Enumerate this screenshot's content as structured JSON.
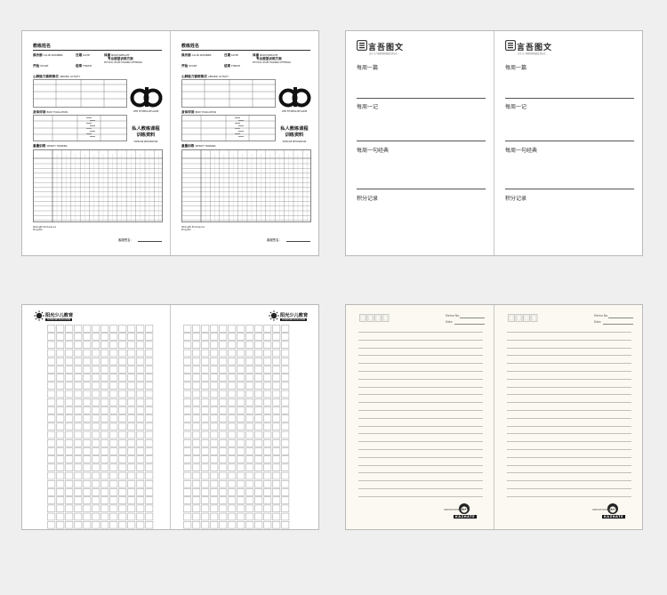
{
  "colors": {
    "background": "#efefef",
    "paper": "#ffffff",
    "paper_cream": "#fbf9f1",
    "grid_line": "#9a9a9a",
    "text": "#222222"
  },
  "training": {
    "title": "教练姓名",
    "club_label": "俱乐部",
    "club_en": "CLUB NUMBER",
    "date_label": "日期",
    "date_en": "DATE",
    "address_label": "开始",
    "address_en": "START",
    "end_label": "结束",
    "end_en": "FINISH",
    "weight_label": "体重",
    "weight_en": "BODYWEIGHT",
    "goal_label": "专业塑型训练方案",
    "goal_en": "PHYSICAL SHAPE TRAINING OFFERINGS",
    "sec1": "心肺能力锻炼情况",
    "sec1_en": "AEROBIC ACTIVITY",
    "sec2": "身体评测",
    "sec2_en": "BODY EVALUATION",
    "sec3": "重量训练",
    "sec3_en": "WEIGHT TRAINING",
    "logo_caption": "DFB FITNESS BFLGRIE",
    "brand_cn": "私人教练课程\n训练资料",
    "brand_en": "EXERCISE INFORMATION",
    "footnote": "Strength Endurance\nProgram",
    "sign_label": "客服签名："
  },
  "reading": {
    "brand": "言吾图文",
    "brand_sub": "文字 让人更美好的阅读生活方式",
    "labels": [
      "每周一篇",
      "每周一记",
      "每周一句经典",
      "积分记录"
    ]
  },
  "grid": {
    "title": "阳光少儿教育",
    "subtitle": "SUNSHINE EDUCATION"
  },
  "lined": {
    "memo_label": "Memo No.",
    "date_label": "Date",
    "brand": "KAZHATE",
    "brand_sub": "CREATIVE NOTEBOOK"
  }
}
